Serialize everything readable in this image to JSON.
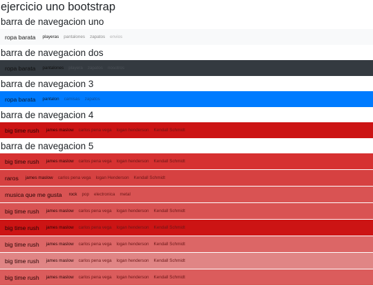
{
  "title": "ejercicio uno bootstrap",
  "section1": {
    "heading": "barra de navegacion uno",
    "brand": "ropa barata",
    "links": [
      "playeras",
      "pantalones",
      "zapatos",
      "envios"
    ]
  },
  "section2": {
    "heading": "barra de navegacion dos",
    "brand": "ropa barata",
    "links": [
      "pantalones",
      "playera",
      "zapatos",
      "nosotros"
    ]
  },
  "section3": {
    "heading": "barra de navegacion 3",
    "brand": "ropa barata",
    "links": [
      "pantalon",
      "camisas",
      "zapatos"
    ]
  },
  "section4": {
    "heading": "barra de navegacion 4",
    "brand": "big time rush",
    "links": [
      "james maslow",
      "carlos pena vega",
      "logan henderson",
      "Kendall Schmidt"
    ]
  },
  "section5": {
    "heading": "barra de navegacion 5",
    "navbars": [
      {
        "brand": "big time rush",
        "links": [
          "james maslow",
          "carlos pena vega",
          "logan henderson",
          "Kendall Schmidt"
        ]
      },
      {
        "brand": "raros",
        "links": [
          "james maslow",
          "carlos pena vega",
          "logan Henderson",
          "Kendall Schmidt"
        ]
      },
      {
        "brand": "musica que me gusta",
        "links": [
          "rock",
          "pop",
          "electronica",
          "metal"
        ]
      },
      {
        "brand": "big time rush",
        "links": [
          "james maslow",
          "carlos pena vega",
          "logan henderson",
          "Kendall Schmidt"
        ]
      },
      {
        "brand": "big time rush",
        "links": [
          "james maslow",
          "carlos pena vega",
          "logan henderson",
          "Kendall Schmidt"
        ]
      },
      {
        "brand": "big time rush",
        "links": [
          "james maslow",
          "carlos pena vega",
          "logan henderson",
          "Kendall Schmidt"
        ]
      },
      {
        "brand": "big time rush",
        "links": [
          "james maslow",
          "carlos pena vega",
          "logan henderson",
          "Kendall Schmidt"
        ]
      },
      {
        "brand": "big time rush",
        "links": [
          "james maslow",
          "carlos pena vega",
          "logan henderson",
          "Kendall Schmidt"
        ]
      }
    ]
  },
  "colors": {
    "light": "#f8f9fa",
    "dark": "#343a40",
    "primary": "#007bff",
    "red_strong": "#cc1414",
    "red_shades": [
      "#d63131",
      "#d64141",
      "#d95353",
      "#d95353",
      "#cc1414",
      "#dc6666",
      "#e08585",
      "#db5c5c"
    ]
  }
}
